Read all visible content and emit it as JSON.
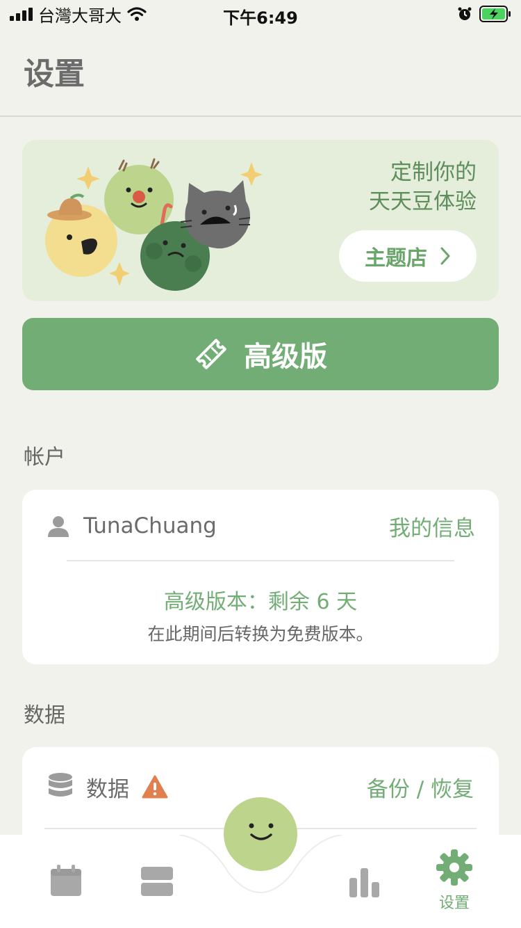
{
  "status_bar": {
    "carrier": "台灣大哥大",
    "time": "下午6:49"
  },
  "header": {
    "title": "设置"
  },
  "theme_banner": {
    "line1": "定制你的",
    "line2": "天天豆体验",
    "button_label": "主题店"
  },
  "premium_button": {
    "label": "高级版",
    "icon": "ticket-icon"
  },
  "account_section": {
    "label": "帐户",
    "username": "TunaChuang",
    "link": "我的信息",
    "plan_status": "高级版本：剩余 6 天",
    "plan_note": "在此期间后转换为免费版本。"
  },
  "data_section": {
    "label": "数据",
    "row_label": "数据",
    "row_action": "备份 / 恢复",
    "warning_color": "#e27f4f"
  },
  "tab_bar": {
    "tabs": [
      {
        "icon": "calendar-icon",
        "label": ""
      },
      {
        "icon": "list-icon",
        "label": ""
      },
      {
        "icon": "mood-face-icon",
        "label": ""
      },
      {
        "icon": "stats-icon",
        "label": ""
      },
      {
        "icon": "gear-icon",
        "label": "设置",
        "active": true
      }
    ]
  },
  "colors": {
    "accent": "#72ad75",
    "background": "#f2f2ec",
    "banner": "#e5eedb"
  }
}
